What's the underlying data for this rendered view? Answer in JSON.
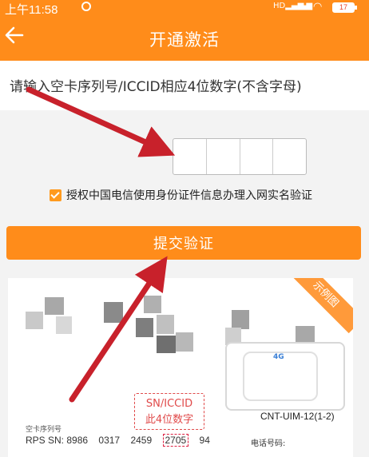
{
  "status_bar": {
    "time": "上午11:58",
    "battery": "17"
  },
  "header": {
    "title": "开通激活",
    "back_icon": "arrow-left-icon"
  },
  "instruction": {
    "text": "请输入空卡序列号/ICCID相应4位数字(不含字母)"
  },
  "code_input": {
    "cells": [
      "",
      "",
      "",
      ""
    ]
  },
  "agreement": {
    "checked": true,
    "text": "授权中国电信使用身份证件信息办理入网实名验证"
  },
  "submit": {
    "label": "提交验证"
  },
  "sample_card": {
    "ribbon": "示例图",
    "sn_hint_line1": "SN/ICCID",
    "sn_hint_line2": "此4位数字",
    "model": "CNT-UIM-12(1-2)",
    "serial_label": "空卡序列号",
    "rps_label": "RPS SN:",
    "rps_digits": [
      "8986",
      "0317",
      "2459",
      "2705",
      "94"
    ],
    "phone_label": "电话号码:",
    "sim_logo": "4G"
  },
  "colors": {
    "brand": "#ff8c1a",
    "arrow": "#c8212b",
    "hint": "#e04a4a"
  }
}
